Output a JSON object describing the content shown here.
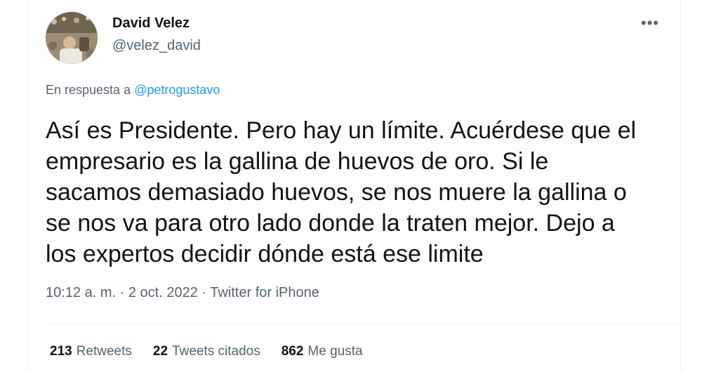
{
  "author": {
    "name": "David Velez",
    "handle": "@velez_david"
  },
  "reply_to": {
    "prefix": "En respuesta a",
    "mention": "@petrogustavo"
  },
  "tweet": {
    "text_lines": [
      "Así es Presidente. Pero hay un límite. Acuérdese que el",
      "empresario es la gallina de huevos de oro. Si le",
      "sacamos demasiado huevos, se nos muere la gallina o",
      "se nos va para otro lado donde la traten mejor. Dejo a",
      "los expertos decidir dónde está ese limite"
    ]
  },
  "meta": {
    "time": "10:12 a. m.",
    "date": "2 oct. 2022",
    "source": "Twitter for iPhone"
  },
  "stats": {
    "retweets_count": "213",
    "retweets_label": "Retweets",
    "quotes_count": "22",
    "quotes_label": "Tweets citados",
    "likes_count": "862",
    "likes_label": "Me gusta"
  },
  "icons": {
    "more": "more-options-icon",
    "avatar": "user-avatar"
  }
}
